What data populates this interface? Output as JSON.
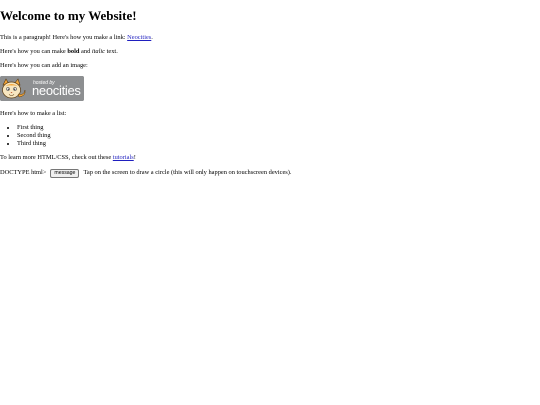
{
  "heading": "Welcome to my Website!",
  "paragraph_link": {
    "before": "This is a paragraph! Here's how you make a link: ",
    "link_text": "Neocities",
    "after": "."
  },
  "bold_italic": {
    "before": "Here's how you can make ",
    "bold": "bold",
    "middle": " and ",
    "italic": "italic",
    "after": " text."
  },
  "image_intro": "Here's how you can add an image:",
  "badge": {
    "small_text": "hosted by",
    "big_text": "neocities",
    "icon": "neocities-cat-logo"
  },
  "list_intro": "Here's how to make a list:",
  "list_items": [
    "First thing",
    "Second thing",
    "Third thing"
  ],
  "tutorials": {
    "before": "To learn more HTML/CSS, check out these ",
    "link_text": "tutorials",
    "after": "!"
  },
  "footer": {
    "prefix": "DOCTYPE html>",
    "button_label": "message",
    "after": "Tap on the screen to draw a circle (this will only happen on touchscreen devices)."
  },
  "colors": {
    "link": "#1f1fbf",
    "badge_bg": "#8d8f91",
    "cat_orange": "#f3a63a"
  }
}
